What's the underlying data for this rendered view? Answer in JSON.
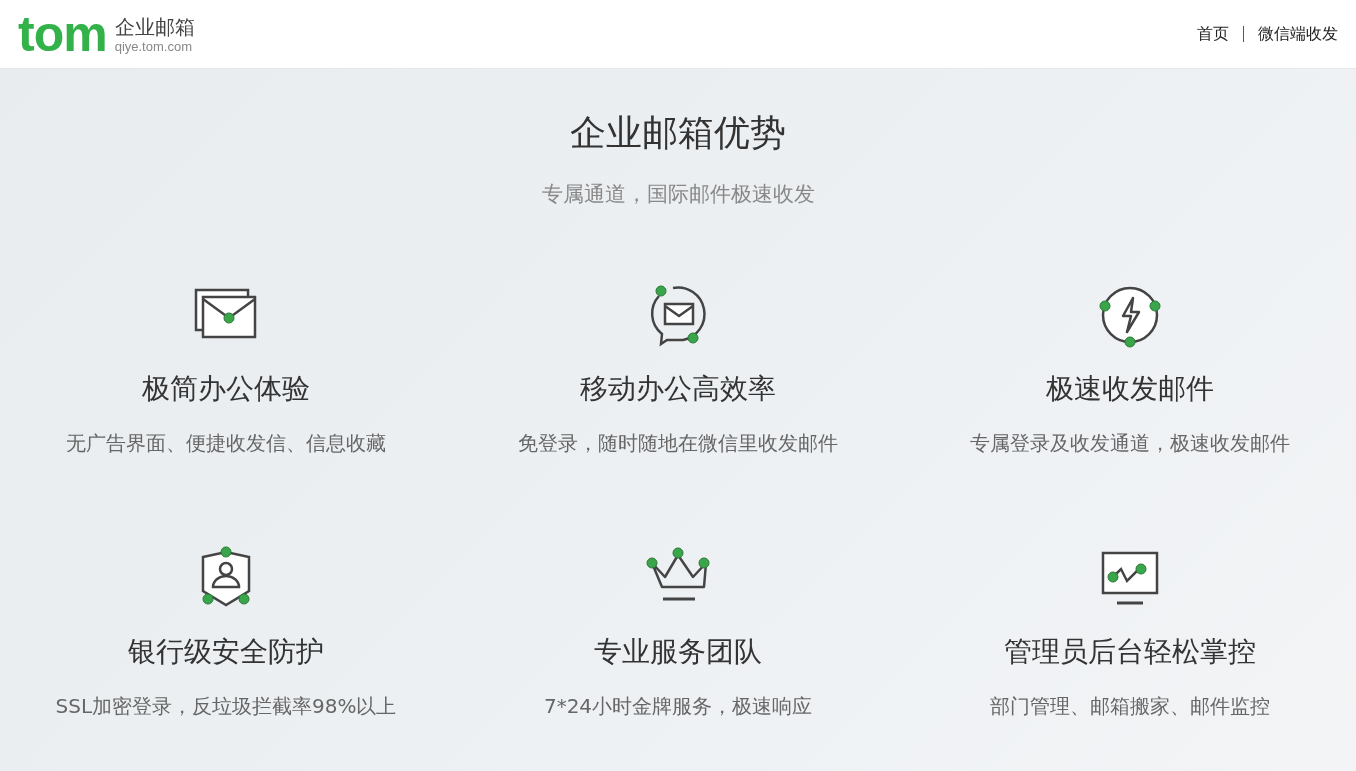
{
  "header": {
    "logo": {
      "wordmark": "tom",
      "product": "企业邮箱",
      "domain": "qiye.tom.com"
    },
    "nav": [
      {
        "label": "首页"
      },
      {
        "label": "微信端收发"
      }
    ]
  },
  "hero": {
    "title": "企业邮箱优势",
    "subtitle": "专属通道，国际邮件极速收发"
  },
  "features": [
    {
      "title": "极简办公体验",
      "description": "无广告界面、便捷收发信、信息收藏"
    },
    {
      "title": "移动办公高效率",
      "description": "免登录，随时随地在微信里收发邮件"
    },
    {
      "title": "极速收发邮件",
      "description": "专属登录及收发通道，极速收发邮件"
    },
    {
      "title": "银行级安全防护",
      "description": "SSL加密登录，反垃圾拦截率98%以上"
    },
    {
      "title": "专业服务团队",
      "description": "7*24小时金牌服务，极速响应"
    },
    {
      "title": "管理员后台轻松掌控",
      "description": "部门管理、邮箱搬家、邮件监控"
    }
  ]
}
